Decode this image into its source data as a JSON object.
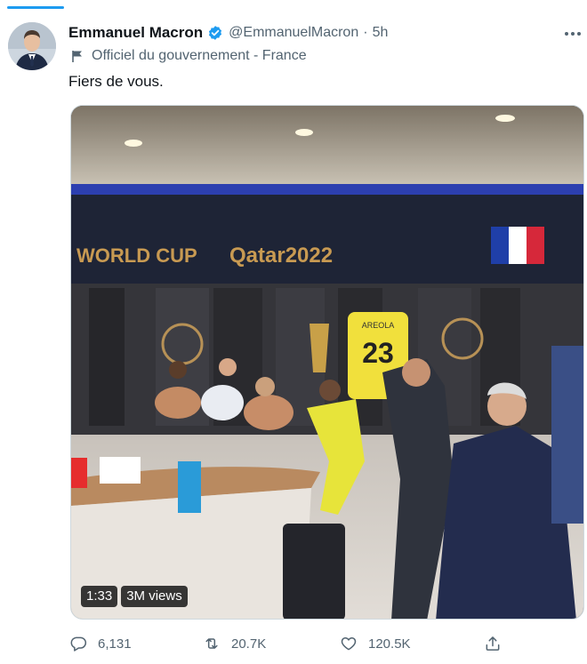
{
  "author": {
    "name": "Emmanuel Macron",
    "handle": "@EmmanuelMacron",
    "separator": "·",
    "time": "5h",
    "label": "Officiel du gouvernement - France"
  },
  "tweet": {
    "text": "Fiers de vous."
  },
  "video": {
    "duration": "1:33",
    "views": "3M views",
    "scene_text": {
      "banner": "WORLD CUP",
      "banner_brand": "Qatar2022",
      "jersey_name": "AREOLA",
      "jersey_number": "23"
    }
  },
  "actions": {
    "replies": "6,131",
    "retweets": "20.7K",
    "likes": "120.5K"
  },
  "colors": {
    "accent": "#1d9bf0",
    "text_secondary": "#536471",
    "verified": "#1d9bf0"
  },
  "icons": [
    "verified-badge-icon",
    "more-icon",
    "government-flag-icon",
    "reply-icon",
    "retweet-icon",
    "like-icon",
    "share-icon"
  ]
}
